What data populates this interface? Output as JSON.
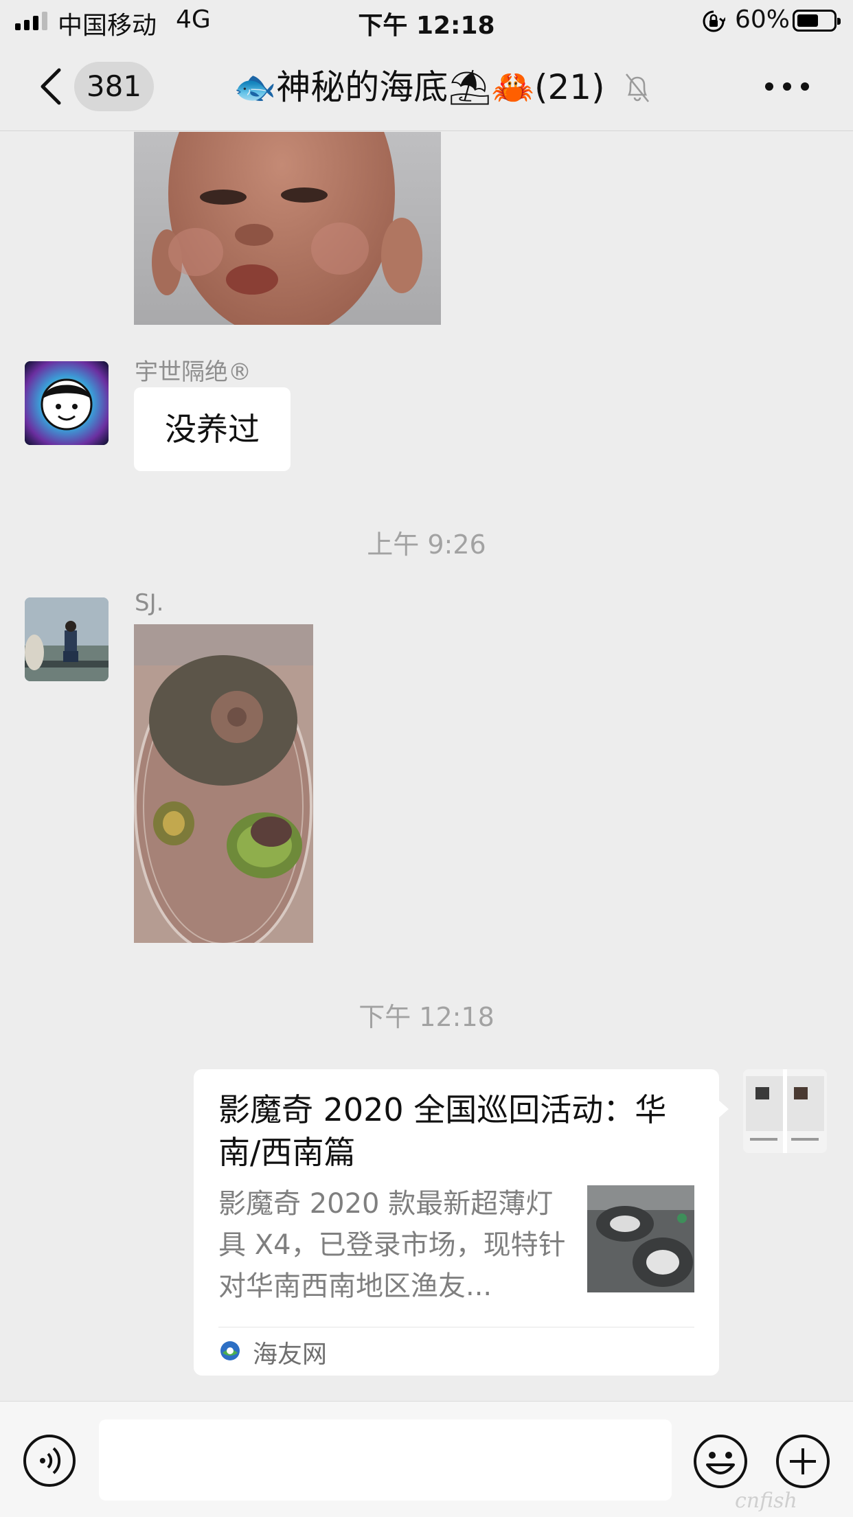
{
  "status_bar": {
    "carrier": "中国移动",
    "network": "4G",
    "time": "下午 12:18",
    "battery_percent": "60%",
    "battery_level": 0.6
  },
  "nav": {
    "unread_count": "381",
    "title": "🐟神秘的海底⛱🦀(21)"
  },
  "messages": {
    "msg1": {
      "sender": "宇世隔绝®",
      "text": "没养过"
    },
    "timestamp1": "上午 9:26",
    "msg2": {
      "sender": "SJ."
    },
    "timestamp2": "下午 12:18",
    "card": {
      "title": "影魔奇 2020 全国巡回活动：华南/西南篇",
      "description": "影魔奇 2020 款最新超薄灯具 X4，已登录市场，现特针对华南西南地区渔友...",
      "source": "海友网"
    }
  },
  "input_bar": {
    "placeholder": ""
  },
  "icons": {
    "back": "chevron-left-icon",
    "mute": "bell-off-icon",
    "more": "more-icon",
    "voice": "voice-icon",
    "emoji": "emoji-icon",
    "plus": "plus-icon"
  },
  "watermark": "cnfish"
}
